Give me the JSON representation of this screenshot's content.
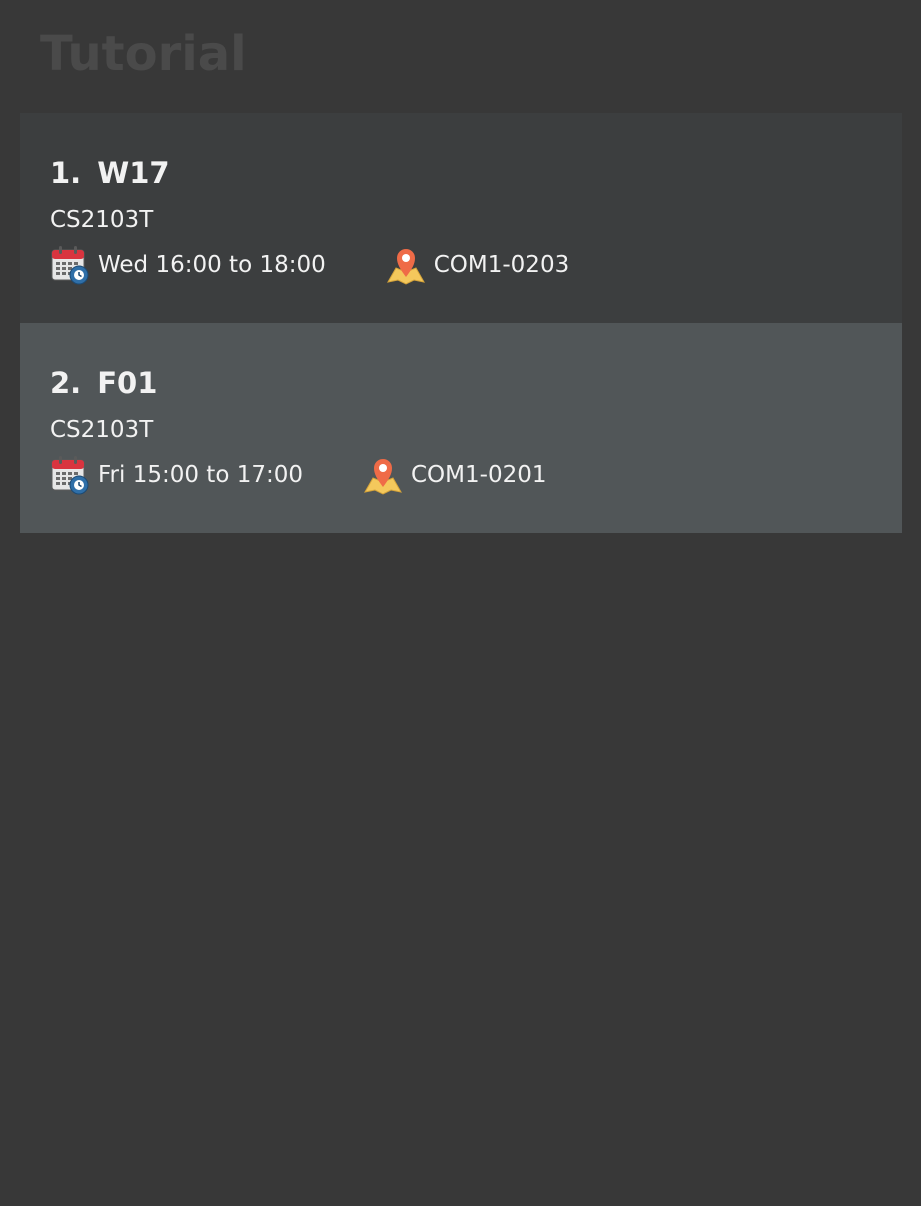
{
  "header": {
    "title": "Tutorial"
  },
  "tutorials": [
    {
      "index": "1.",
      "name": "W17",
      "module": "CS2103T",
      "time": "Wed 16:00 to 18:00",
      "venue": "COM1-0203",
      "time_icon": "calendar-clock-icon",
      "venue_icon": "map-pin-icon"
    },
    {
      "index": "2.",
      "name": "F01",
      "module": "CS2103T",
      "time": "Fri 15:00 to 17:00",
      "venue": "COM1-0201",
      "time_icon": "calendar-clock-icon",
      "venue_icon": "map-pin-icon",
      "selected": true
    }
  ],
  "colors": {
    "background": "#383838",
    "card_even": "#3c3e3f",
    "card_selected": "#515658",
    "title_text": "#4a4a4a",
    "body_text": "#f2f2f2",
    "calendar_red": "#d9343f",
    "pin_orange": "#ef6b47",
    "map_yellow": "#f4c85c"
  }
}
